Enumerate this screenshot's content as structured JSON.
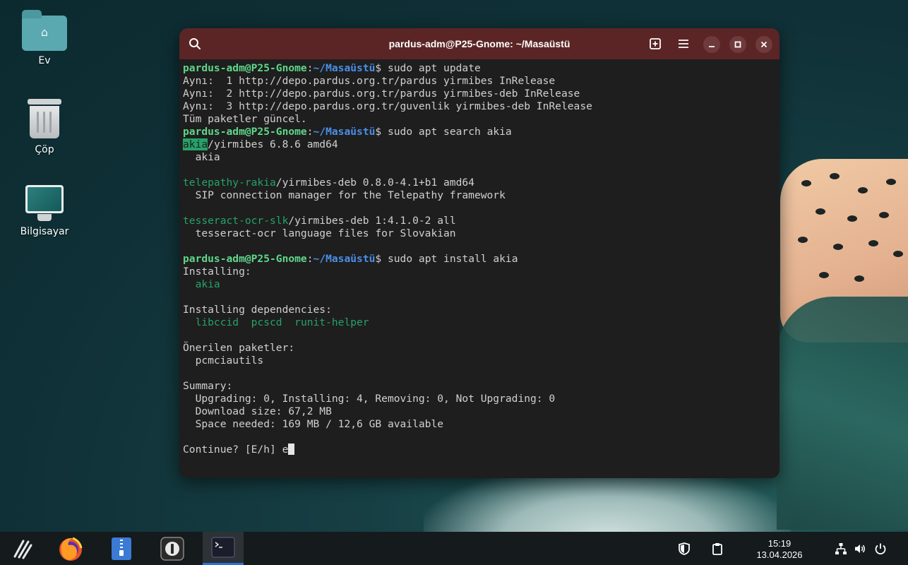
{
  "desktop": {
    "icons": [
      {
        "label": "Ev",
        "icon": "home-folder-icon"
      },
      {
        "label": "Çöp",
        "icon": "trash-icon"
      },
      {
        "label": "Bilgisayar",
        "icon": "computer-icon"
      }
    ]
  },
  "terminal": {
    "title": "pardus-adm@P25-Gnome: ~/Masaüstü",
    "prompt_user": "pardus-adm@P25-Gnome",
    "prompt_sep": ":",
    "prompt_path": "~/Masaüstü",
    "prompt_suffix": "$ ",
    "lines": {
      "cmd1": "sudo apt update",
      "l2": "Aynı:  1 http://depo.pardus.org.tr/pardus yirmibes InRelease",
      "l3": "Aynı:  2 http://depo.pardus.org.tr/pardus yirmibes-deb InRelease",
      "l4": "Aynı:  3 http://depo.pardus.org.tr/guvenlik yirmibes-deb InRelease",
      "l5": "Tüm paketler güncel.",
      "cmd2": "sudo apt search akia",
      "r1_name": "akia",
      "r1_rest": "/yirmibes 6.8.6 amd64",
      "r1_desc": "  akia",
      "r2_name": "telepathy-rakia",
      "r2_rest": "/yirmibes-deb 0.8.0-4.1+b1 amd64",
      "r2_desc": "  SIP connection manager for the Telepathy framework",
      "r3_name": "tesseract-ocr-slk",
      "r3_rest": "/yirmibes-deb 1:4.1.0-2 all",
      "r3_desc": "  tesseract-ocr language files for Slovakian",
      "cmd3": "sudo apt install akia",
      "installing": "Installing:",
      "installing_pkg": "akia",
      "deps_header": "Installing dependencies:",
      "deps": "libccid  pcscd  runit-helper",
      "suggested_header": "Önerilen paketler:",
      "suggested": "  pcmciautils",
      "summary_header": "Summary:",
      "summary1": "  Upgrading: 0, Installing: 4, Removing: 0, Not Upgrading: 0",
      "summary2": "  Download size: 67,2 MB",
      "summary3": "  Space needed: 169 MB / 12,6 GB available",
      "continue": "Continue? [E/h] e"
    }
  },
  "taskbar": {
    "apps": [
      "pardus-menu-icon",
      "firefox-icon",
      "file-manager-icon",
      "password-manager-icon",
      "terminal-icon"
    ],
    "clock_time": "15:19",
    "clock_date": "13.04.2026",
    "colors": {
      "accent": "#2f6fd6",
      "titlebar": "#5b2526",
      "prompt_user": "#5fd68a",
      "prompt_path": "#4a8fe8",
      "package_name": "#26a269"
    }
  }
}
